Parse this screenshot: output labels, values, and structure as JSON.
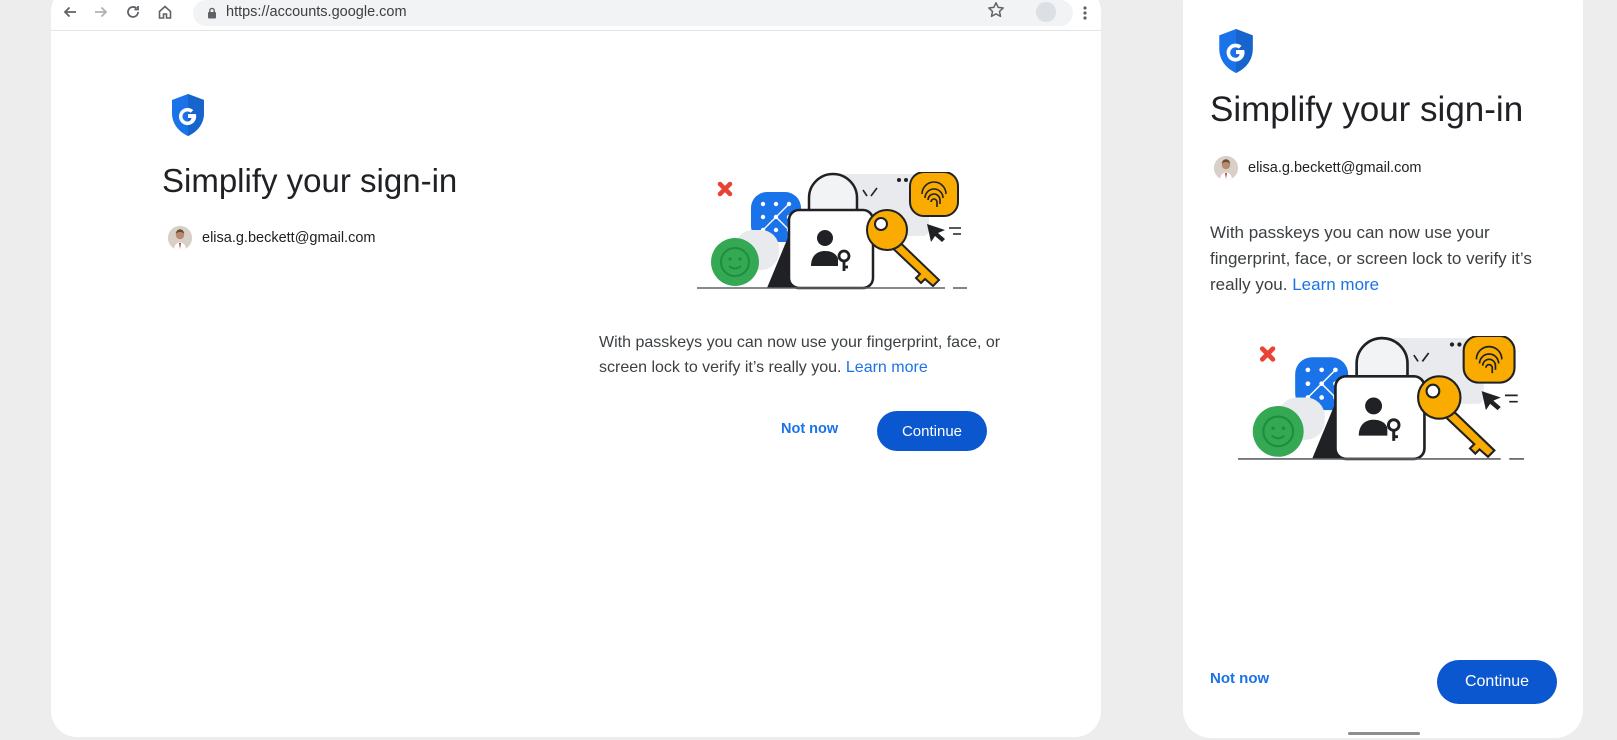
{
  "browser": {
    "url": "https://accounts.google.com"
  },
  "desktop": {
    "title": "Simplify your sign-in",
    "account_email": "elisa.g.beckett@gmail.com",
    "body_text": "With passkeys you can now use your fingerprint, face, or screen lock to verify it’s really you. ",
    "learn_more": "Learn more",
    "not_now": "Not now",
    "continue": "Continue"
  },
  "mobile": {
    "title": "Simplify your sign-in",
    "account_email": "elisa.g.beckett@gmail.com",
    "body_text": "With passkeys you can now use your fingerprint, face, or screen lock to verify it’s really you. ",
    "learn_more": "Learn more",
    "not_now": "Not now",
    "continue": "Continue"
  },
  "icons": {
    "back": "arrow-back-icon",
    "forward": "arrow-forward-icon",
    "reload": "reload-icon",
    "home": "home-icon",
    "lock": "lock-icon",
    "bookmark": "star-icon",
    "menu": "more-vert-icon",
    "shield": "google-shield-icon",
    "illustration": "passkey-illustration"
  },
  "colors": {
    "primary": "#0b57d0",
    "link": "#1a73e8",
    "shield": "#1a73e8",
    "key_yellow": "#f9ab00",
    "face_green": "#34a853",
    "pattern_blue": "#1a73e8",
    "cross_red": "#ea4335"
  }
}
